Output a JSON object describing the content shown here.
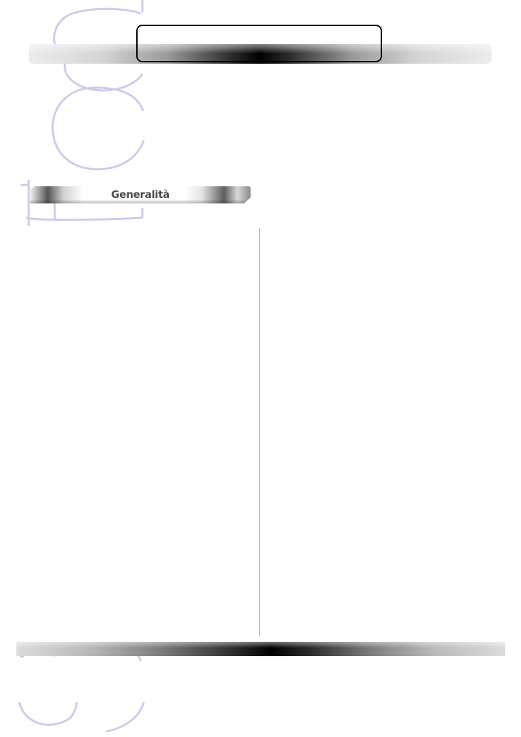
{
  "header": {
    "title": ""
  },
  "section": {
    "title": "Generalità"
  },
  "colors": {
    "watermark": "#cbcbec",
    "title_border": "#000000",
    "divider": "#8a8a8a",
    "tab_text": "#4a4a4a"
  }
}
